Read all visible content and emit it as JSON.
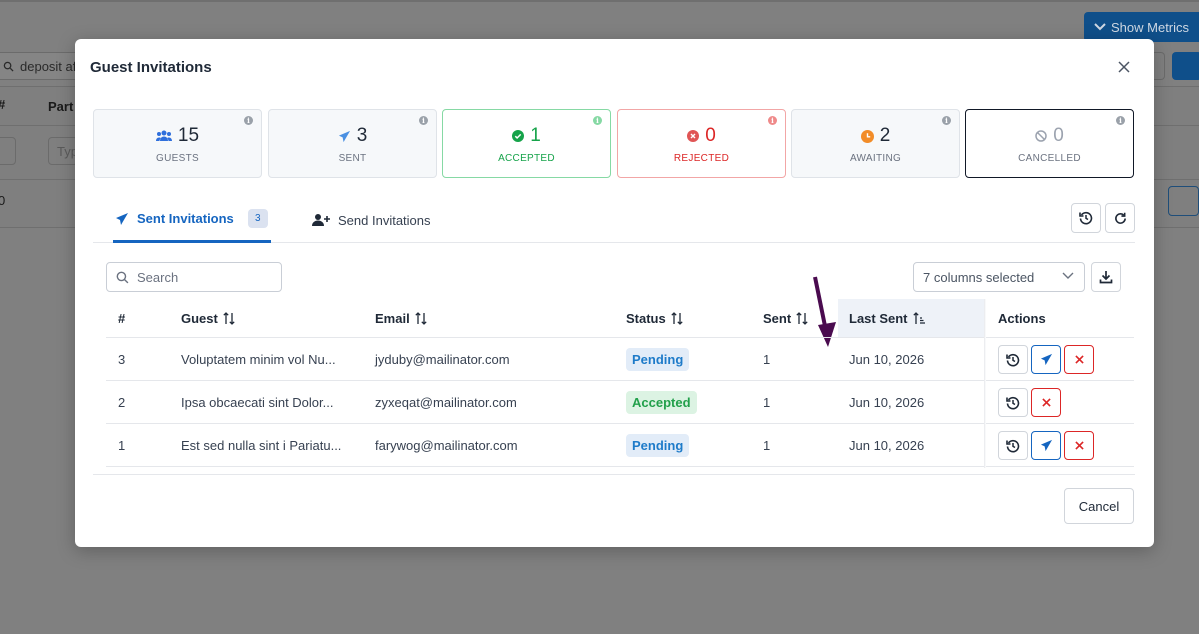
{
  "background": {
    "metrics_button": "Show Metrics",
    "search_value": "deposit af",
    "col_header_hash": "#",
    "col_header_part": "Part",
    "filter_placeholder": "Typ",
    "row_value": "0"
  },
  "modal": {
    "title": "Guest Invitations",
    "stats": [
      {
        "value": "15",
        "label": "GUESTS",
        "icon": "users-icon",
        "color": "#2f6fdc"
      },
      {
        "value": "3",
        "label": "SENT",
        "icon": "paper-plane-icon",
        "color": "#4a90e2"
      },
      {
        "value": "1",
        "label": "ACCEPTED",
        "icon": "check-circle-icon",
        "color": "#16a34a"
      },
      {
        "value": "0",
        "label": "REJECTED",
        "icon": "x-circle-icon",
        "color": "#dc2626"
      },
      {
        "value": "2",
        "label": "AWAITING",
        "icon": "clock-icon",
        "color": "#f28c28"
      },
      {
        "value": "0",
        "label": "CANCELLED",
        "icon": "ban-icon",
        "color": "#9ca3af"
      }
    ],
    "tabs": {
      "sent_label": "Sent Invitations",
      "sent_count": "3",
      "send_label": "Send Invitations"
    },
    "search_placeholder": "Search",
    "columns_selected": "7 columns selected",
    "table": {
      "headers": {
        "num": "#",
        "guest": "Guest",
        "email": "Email",
        "status": "Status",
        "sent": "Sent",
        "last_sent": "Last Sent",
        "actions": "Actions"
      },
      "rows": [
        {
          "num": "3",
          "guest": "Voluptatem minim vol Nu...",
          "email": "jyduby@mailinator.com",
          "status": "Pending",
          "sent": "1",
          "last_sent": "Jun 10, 2026"
        },
        {
          "num": "2",
          "guest": "Ipsa obcaecati sint Dolor...",
          "email": "zyxeqat@mailinator.com",
          "status": "Accepted",
          "sent": "1",
          "last_sent": "Jun 10, 2026"
        },
        {
          "num": "1",
          "guest": "Est sed nulla sint i Pariatu...",
          "email": "farywog@mailinator.com",
          "status": "Pending",
          "sent": "1",
          "last_sent": "Jun 10, 2026"
        }
      ]
    },
    "cancel_button": "Cancel"
  },
  "colors": {
    "primary": "#1565c0",
    "accepted": "#16a34a",
    "rejected": "#dc2626",
    "awaiting": "#f28c28",
    "annotation_arrow": "#4a0b4f"
  }
}
